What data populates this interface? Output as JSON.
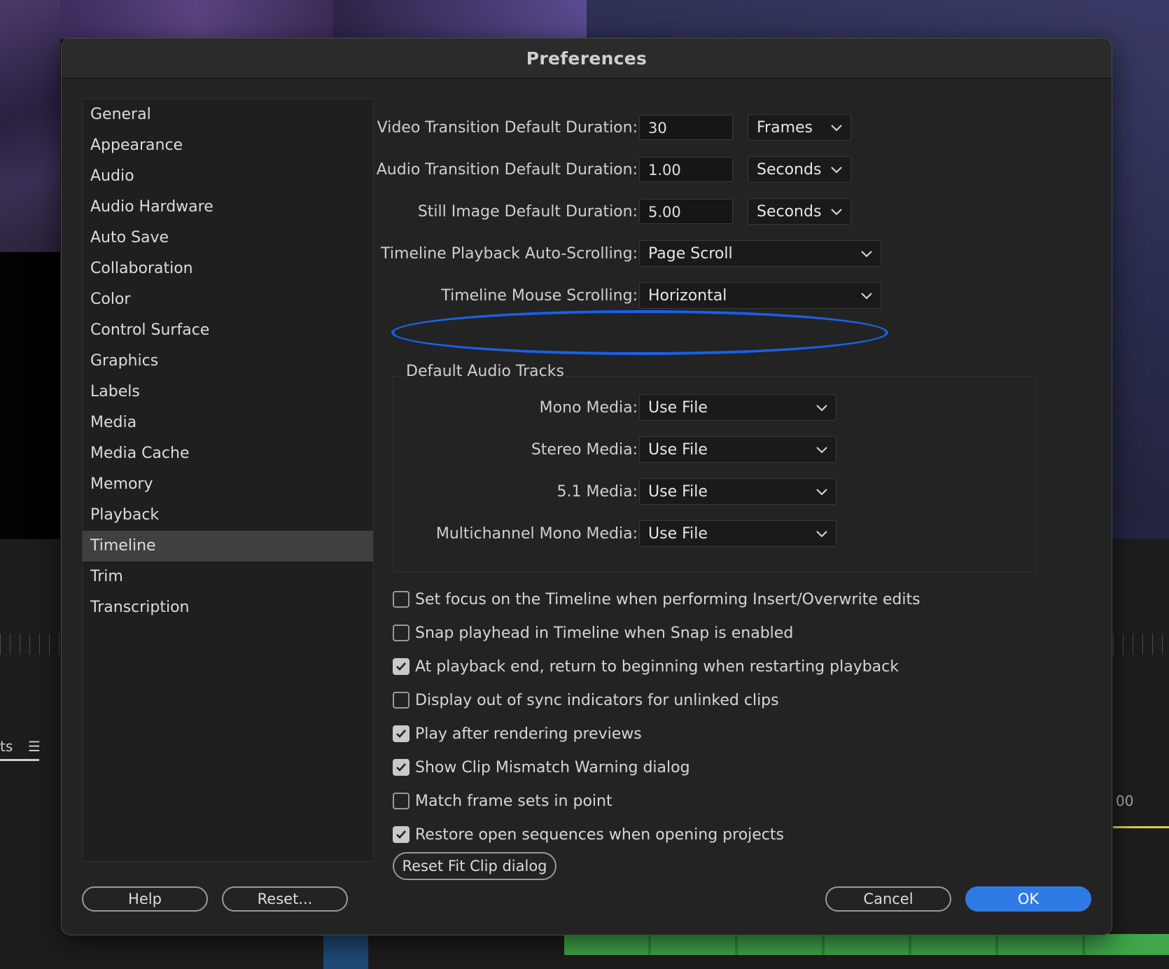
{
  "dialog": {
    "title": "Preferences"
  },
  "sidebar": {
    "items": [
      {
        "label": "General"
      },
      {
        "label": "Appearance"
      },
      {
        "label": "Audio"
      },
      {
        "label": "Audio Hardware"
      },
      {
        "label": "Auto Save"
      },
      {
        "label": "Collaboration"
      },
      {
        "label": "Color"
      },
      {
        "label": "Control Surface"
      },
      {
        "label": "Graphics"
      },
      {
        "label": "Labels"
      },
      {
        "label": "Media"
      },
      {
        "label": "Media Cache"
      },
      {
        "label": "Memory"
      },
      {
        "label": "Playback"
      },
      {
        "label": "Timeline",
        "selected": true
      },
      {
        "label": "Trim"
      },
      {
        "label": "Transcription"
      }
    ]
  },
  "timeline": {
    "video_transition": {
      "label": "Video Transition Default Duration:",
      "value": "30",
      "unit": "Frames"
    },
    "audio_transition": {
      "label": "Audio Transition Default Duration:",
      "value": "1.00",
      "unit": "Seconds"
    },
    "still_image": {
      "label": "Still Image Default Duration:",
      "value": "5.00",
      "unit": "Seconds"
    },
    "playback_autoscroll": {
      "label": "Timeline Playback Auto-Scrolling:",
      "value": "Page Scroll"
    },
    "mouse_scrolling": {
      "label": "Timeline Mouse Scrolling:",
      "value": "Horizontal"
    },
    "default_audio_tracks": {
      "title": "Default Audio Tracks",
      "mono": {
        "label": "Mono Media:",
        "value": "Use File"
      },
      "stereo": {
        "label": "Stereo Media:",
        "value": "Use File"
      },
      "five_one": {
        "label": "5.1 Media:",
        "value": "Use File"
      },
      "multichannel": {
        "label": "Multichannel Mono Media:",
        "value": "Use File"
      }
    },
    "checkboxes": [
      {
        "label": "Set focus on the Timeline when performing Insert/Overwrite edits",
        "checked": false
      },
      {
        "label": "Snap playhead in Timeline when Snap is enabled",
        "checked": false
      },
      {
        "label": "At playback end, return to beginning when restarting playback",
        "checked": true
      },
      {
        "label": "Display out of sync indicators for unlinked clips",
        "checked": false
      },
      {
        "label": "Play after rendering previews",
        "checked": true
      },
      {
        "label": "Show Clip Mismatch Warning dialog",
        "checked": true
      },
      {
        "label": "Match frame sets in point",
        "checked": false
      },
      {
        "label": "Restore open sequences when opening projects",
        "checked": true
      }
    ],
    "reset_fit_clip_label": "Reset Fit Clip dialog"
  },
  "footer": {
    "help_label": "Help",
    "reset_label": "Reset...",
    "cancel_label": "Cancel",
    "ok_label": "OK"
  },
  "background": {
    "tab_fragment": "ts",
    "ruler_fragment": "00"
  },
  "colors": {
    "accent": "#2f7be6",
    "highlight_ring": "#1861e8"
  }
}
